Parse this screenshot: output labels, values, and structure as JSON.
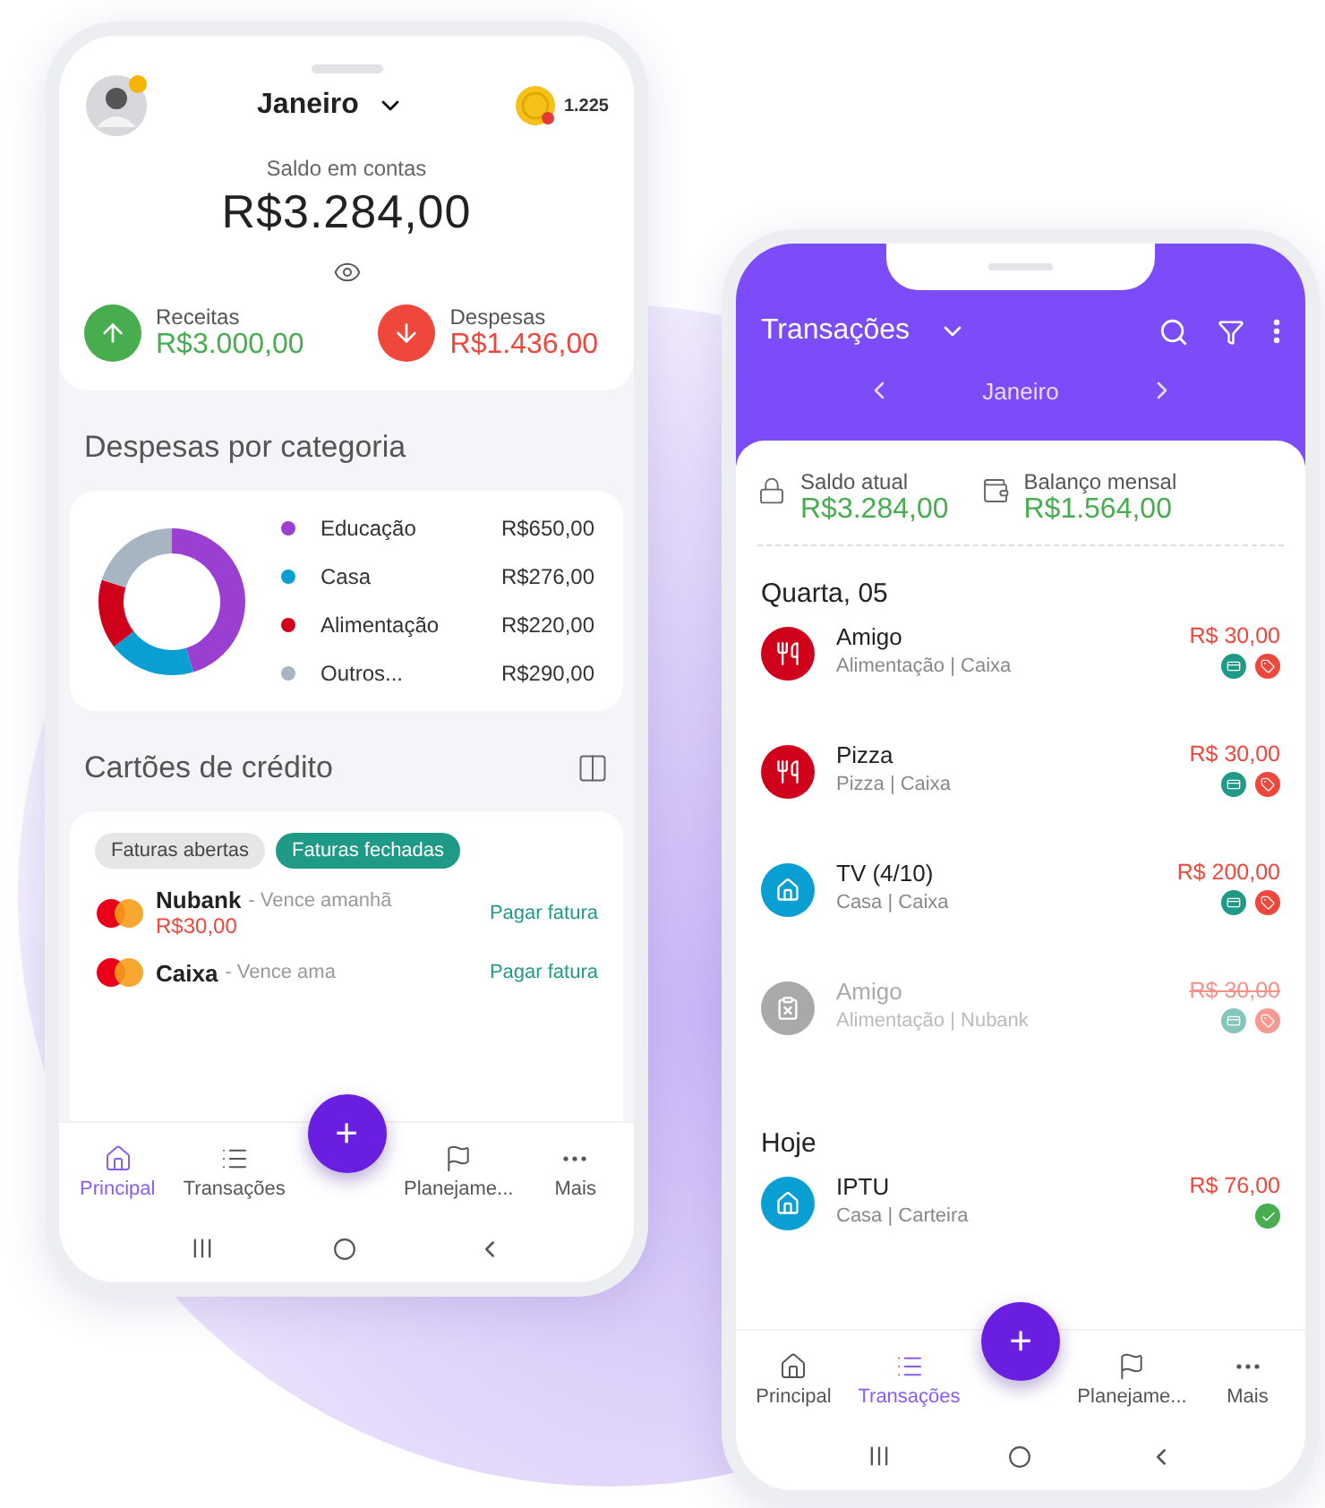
{
  "home_screen": {
    "header": {
      "month": "Janeiro",
      "points": "1.225"
    },
    "balance": {
      "label": "Saldo em contas",
      "value": "R$3.284,00"
    },
    "totals": [
      {
        "kind": "income",
        "label": "Receitas",
        "value": "R$3.000,00"
      },
      {
        "kind": "expense",
        "label": "Despesas",
        "value": "R$1.436,00"
      }
    ],
    "categories": {
      "title": "Despesas por categoria",
      "chart_data": {
        "type": "donut",
        "categories": [
          "Educação",
          "Casa",
          "Alimentação",
          "Outros..."
        ],
        "values": [
          45.27,
          19.22,
          15.32,
          20.19
        ]
      },
      "legend": [
        {
          "value": "R$650,00",
          "color": "#9b3fd3"
        },
        {
          "value": "R$276,00",
          "color": "#0a9fd3"
        },
        {
          "value": "R$220,00",
          "color": "#d0021b"
        },
        {
          "value": "R$290,00",
          "color": "#a7b5c3"
        }
      ]
    },
    "cards": {
      "title": "Cartões de crédito",
      "filters": [
        {
          "label": "Faturas abertas",
          "selected": false
        },
        {
          "label": "Faturas fechadas",
          "selected": true
        }
      ],
      "items": [
        {
          "name": "Nubank",
          "due": "- Vence amanhã",
          "amount": "R$30,00",
          "action": "Pagar fatura"
        },
        {
          "name": "Caixa",
          "due": "- Vence ama",
          "action": "Pagar fatura"
        }
      ]
    },
    "fab": "+",
    "nav": [
      {
        "kind": "home",
        "label": "Principal",
        "selected": true
      },
      {
        "kind": "list",
        "label": "Transações",
        "selected": false
      },
      {
        "kind": "flag",
        "label": "Planejame...",
        "selected": false
      },
      {
        "kind": "more",
        "label": "Mais",
        "selected": false
      }
    ]
  },
  "transactions_screen": {
    "header": {
      "title": "Transações",
      "month": "Janeiro"
    },
    "summary": [
      {
        "kind": "lock",
        "label": "Saldo atual",
        "value": "R$3.284,00"
      },
      {
        "kind": "wallet",
        "label": "Balanço mensal",
        "value": "R$1.564,00"
      }
    ],
    "groups": [
      {
        "title": "Quarta, 05",
        "items": [
          {
            "name": "Amigo",
            "detail": "Alimentação | Caixa",
            "amount": "R$ 30,00",
            "kind": "food",
            "ignored": false,
            "paid": false
          },
          {
            "name": "Pizza",
            "detail": "Pizza | Caixa",
            "amount": "R$ 30,00",
            "kind": "food",
            "ignored": false,
            "paid": false
          },
          {
            "name": "TV (4/10)",
            "detail": "Casa | Caixa",
            "amount": "R$ 200,00",
            "kind": "home",
            "ignored": false,
            "paid": false
          },
          {
            "name": "Amigo",
            "detail": "Alimentação | Nubank",
            "amount": "R$ 30,00",
            "kind": "food",
            "ignored": true,
            "paid": false
          }
        ]
      },
      {
        "title": "Hoje",
        "items": [
          {
            "name": "IPTU",
            "detail": "Casa | Carteira",
            "amount": "R$ 76,00",
            "kind": "home",
            "ignored": false,
            "paid": true
          }
        ]
      }
    ],
    "fab": "+",
    "nav": [
      {
        "kind": "home",
        "label": "Principal",
        "selected": false
      },
      {
        "kind": "list",
        "label": "Transações",
        "selected": true
      },
      {
        "kind": "flag",
        "label": "Planejame...",
        "selected": false
      },
      {
        "kind": "more",
        "label": "Mais",
        "selected": false
      }
    ]
  }
}
